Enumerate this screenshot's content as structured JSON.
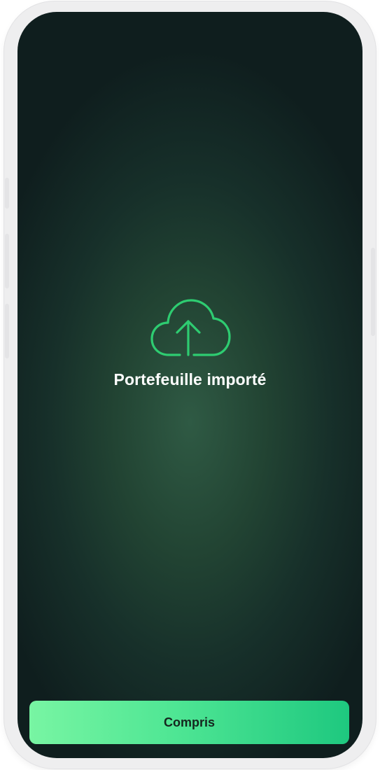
{
  "screen": {
    "icon": "cloud-upload-icon",
    "title": "Portefeuille importé",
    "button_label": "Compris"
  },
  "colors": {
    "accent": "#2ecc71",
    "button_gradient_start": "#78f5a3",
    "button_gradient_end": "#1ec87f",
    "background_center": "#2f5a44",
    "background_edge": "#0f1e1e"
  }
}
